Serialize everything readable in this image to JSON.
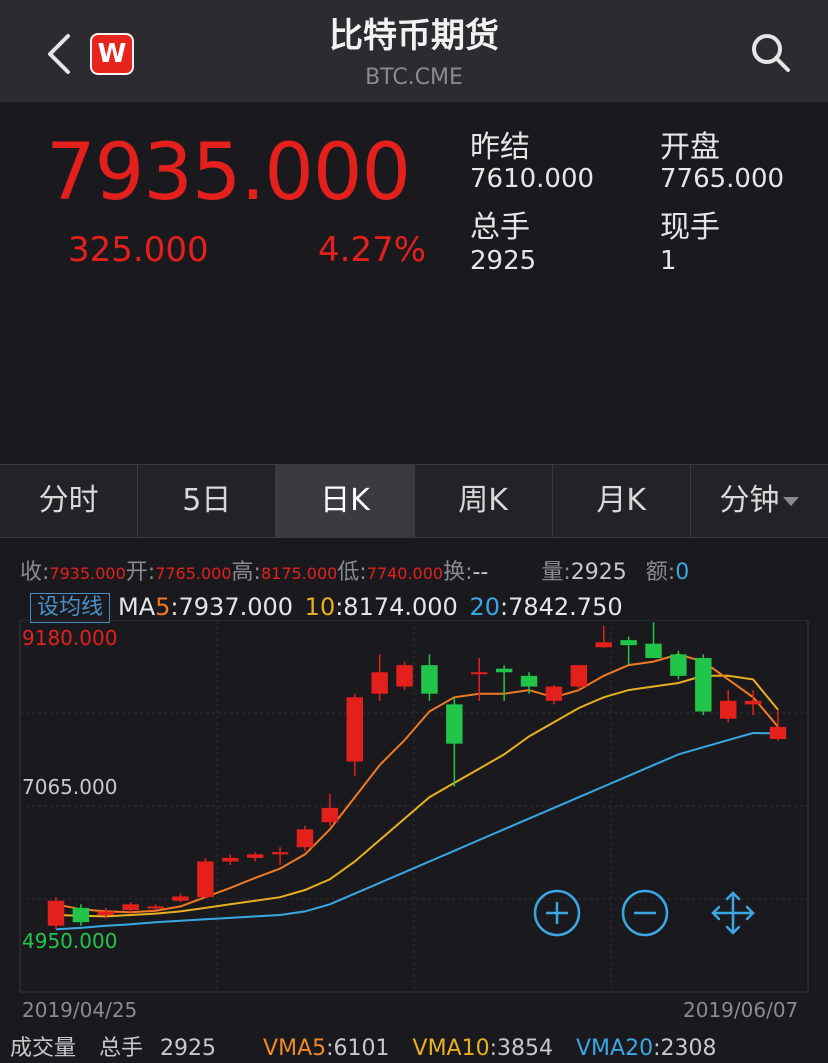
{
  "header": {
    "title": "比特币期货",
    "subtitle": "BTC.CME",
    "logo_letter": "W"
  },
  "quote": {
    "price": "7935.000",
    "change": "325.000",
    "change_pct": "4.27%",
    "stats": [
      {
        "label": "昨结",
        "value": "7610.000"
      },
      {
        "label": "开盘",
        "value": "7765.000"
      },
      {
        "label": "总手",
        "value": "2925"
      },
      {
        "label": "现手",
        "value": "1"
      }
    ]
  },
  "tabs": [
    {
      "label": "分时"
    },
    {
      "label": "5日"
    },
    {
      "label": "日K",
      "active": true
    },
    {
      "label": "周K"
    },
    {
      "label": "月K"
    },
    {
      "label": "分钟"
    }
  ],
  "info": {
    "close_label": "收:",
    "close": "7935.000",
    "open_label": "开:",
    "open": "7765.000",
    "high_label": "高:",
    "high": "8175.000",
    "low_label": "低:",
    "low": "7740.000",
    "turnover_label": "换:",
    "turnover": "--",
    "volume_label": "量:",
    "volume": "2925",
    "amount_label": "额:",
    "amount": "0"
  },
  "ma": {
    "button": "设均线",
    "ma5_label": "MA",
    "ma5_n": "5",
    "ma5": ":7937.000",
    "ma10_n": "10",
    "ma10": ":8174.000",
    "ma20_n": "20",
    "ma20": ":7842.750"
  },
  "axis": {
    "y_top": "9180.000",
    "y_mid": "7065.000",
    "y_bottom": "4950.000",
    "x_start": "2019/04/25",
    "x_end": "2019/06/07"
  },
  "volume_bar": {
    "label": "成交量",
    "total_label": "总手",
    "total": "2925",
    "vma5_label": "VMA5",
    "vma5": ":6101",
    "vma10_label": "VMA10",
    "vma10": ":3854",
    "vma20_label": "VMA20",
    "vma20": ":2308"
  },
  "colors": {
    "up": "#e3201c",
    "down": "#21c54a",
    "ma5": "#f07a24",
    "ma10": "#e8b020",
    "ma20": "#3aa7e3",
    "background": "#1a1a1e"
  },
  "chart_data": {
    "type": "candlestick",
    "ylim": [
      4950,
      9180
    ],
    "candles": [
      {
        "o": 5150,
        "c": 5500,
        "h": 5550,
        "l": 5100
      },
      {
        "o": 5400,
        "c": 5200,
        "h": 5450,
        "l": 5150
      },
      {
        "o": 5300,
        "c": 5350,
        "h": 5400,
        "l": 5250
      },
      {
        "o": 5370,
        "c": 5450,
        "h": 5480,
        "l": 5340
      },
      {
        "o": 5400,
        "c": 5420,
        "h": 5450,
        "l": 5380
      },
      {
        "o": 5500,
        "c": 5560,
        "h": 5600,
        "l": 5480
      },
      {
        "o": 5550,
        "c": 6050,
        "h": 6100,
        "l": 5530
      },
      {
        "o": 6050,
        "c": 6100,
        "h": 6150,
        "l": 6000
      },
      {
        "o": 6100,
        "c": 6150,
        "h": 6180,
        "l": 6050
      },
      {
        "o": 6150,
        "c": 6180,
        "h": 6250,
        "l": 6000
      },
      {
        "o": 6250,
        "c": 6500,
        "h": 6550,
        "l": 6200
      },
      {
        "o": 6600,
        "c": 6800,
        "h": 7000,
        "l": 6550
      },
      {
        "o": 7450,
        "c": 8350,
        "h": 8400,
        "l": 7250
      },
      {
        "o": 8400,
        "c": 8700,
        "h": 8950,
        "l": 8300
      },
      {
        "o": 8500,
        "c": 8800,
        "h": 8850,
        "l": 8450
      },
      {
        "o": 8800,
        "c": 8400,
        "h": 8950,
        "l": 8300
      },
      {
        "o": 8250,
        "c": 7700,
        "h": 8350,
        "l": 7100
      },
      {
        "o": 8700,
        "c": 8700,
        "h": 8900,
        "l": 8300
      },
      {
        "o": 8750,
        "c": 8700,
        "h": 8800,
        "l": 8300
      },
      {
        "o": 8650,
        "c": 8500,
        "h": 8700,
        "l": 8400
      },
      {
        "o": 8300,
        "c": 8500,
        "h": 8520,
        "l": 8250
      },
      {
        "o": 8500,
        "c": 8800,
        "h": 8800,
        "l": 8450
      },
      {
        "o": 9050,
        "c": 9120,
        "h": 9350,
        "l": 9050
      },
      {
        "o": 9150,
        "c": 9080,
        "h": 9200,
        "l": 8800
      },
      {
        "o": 9100,
        "c": 8900,
        "h": 9400,
        "l": 8900
      },
      {
        "o": 8950,
        "c": 8650,
        "h": 9000,
        "l": 8600
      },
      {
        "o": 8900,
        "c": 8150,
        "h": 8950,
        "l": 8100
      },
      {
        "o": 8050,
        "c": 8300,
        "h": 8450,
        "l": 8000
      },
      {
        "o": 8250,
        "c": 8300,
        "h": 8450,
        "l": 8100
      },
      {
        "o": 7765,
        "c": 7935,
        "h": 8175,
        "l": 7740
      }
    ],
    "ma5": [
      5450,
      5380,
      5350,
      5340,
      5360,
      5420,
      5550,
      5680,
      5820,
      5950,
      6150,
      6500,
      6950,
      7400,
      7750,
      8150,
      8350,
      8400,
      8400,
      8450,
      8350,
      8450,
      8650,
      8800,
      8850,
      8950,
      8850,
      8600,
      8350,
      7937
    ],
    "ma10": [
      5300,
      5290,
      5280,
      5300,
      5320,
      5350,
      5400,
      5450,
      5500,
      5550,
      5650,
      5800,
      6050,
      6350,
      6650,
      6950,
      7150,
      7350,
      7550,
      7800,
      8000,
      8200,
      8350,
      8450,
      8500,
      8550,
      8650,
      8650,
      8600,
      8174
    ],
    "ma20": [
      5100,
      5120,
      5150,
      5170,
      5200,
      5220,
      5240,
      5260,
      5280,
      5300,
      5350,
      5450,
      5600,
      5750,
      5900,
      6050,
      6200,
      6350,
      6500,
      6650,
      6800,
      6950,
      7100,
      7250,
      7400,
      7550,
      7650,
      7750,
      7850,
      7842.75
    ]
  }
}
